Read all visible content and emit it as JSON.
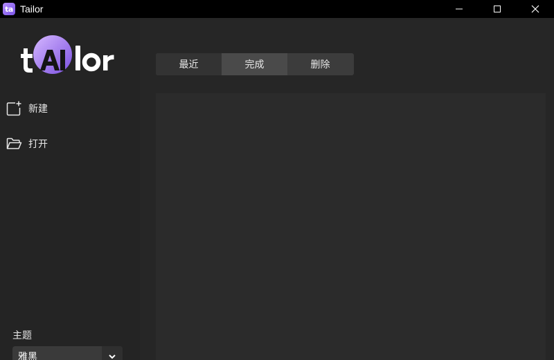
{
  "window": {
    "title": "Tailor",
    "app_icon_text": "ta",
    "controls": [
      "minimize",
      "maximize",
      "close"
    ]
  },
  "sidebar": {
    "logo_text": "tAIlor",
    "items": [
      {
        "label": "新建",
        "icon": "new-file-icon"
      },
      {
        "label": "打开",
        "icon": "folder-open-icon"
      }
    ],
    "theme": {
      "label": "主题",
      "selected": "雅黑"
    }
  },
  "main": {
    "tabs": [
      {
        "label": "最近"
      },
      {
        "label": "完成",
        "active": true
      },
      {
        "label": "删除"
      }
    ]
  },
  "colors": {
    "accent": "#8a5cf6",
    "titlebar": "#000000",
    "background": "#242424"
  }
}
